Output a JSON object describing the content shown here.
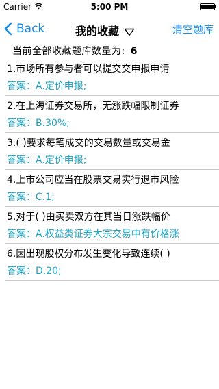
{
  "status_bar": {
    "carrier": "Carrier",
    "time": "5:00 PM",
    "battery_level": 1.0
  },
  "nav": {
    "back_label": "Back",
    "title": "我的收藏",
    "clear_label": "清空题库"
  },
  "count_header": {
    "label": "当前全部收藏题库数量为:",
    "value": "6"
  },
  "colors": {
    "accent_blue": "#1a8ce8",
    "answer_teal": "#1ea6c8",
    "separator": "#c8c7cc"
  },
  "items": [
    {
      "question": "1.市场所有参与者可以提交交申报申请",
      "answer": "答案：A.定价申报;"
    },
    {
      "question": "2.在上海证券交易所，无涨跌幅限制证券",
      "answer": "答案：B.30%;"
    },
    {
      "question": "3.(    )要求每笔成交的交易数量或交易金",
      "answer": "答案：A.定价申报;"
    },
    {
      "question": "4.上市公司应当在股票交易实行退市风险",
      "answer": "答案：C.1;"
    },
    {
      "question": "5.对于(    )由买卖双方在其当日涨跌幅价",
      "answer": "答案：A.权益类证券大宗交易中有价格涨"
    },
    {
      "question": "6.因出现股权分布发生变化导致连续(    )",
      "answer": "答案：D.20;"
    }
  ]
}
